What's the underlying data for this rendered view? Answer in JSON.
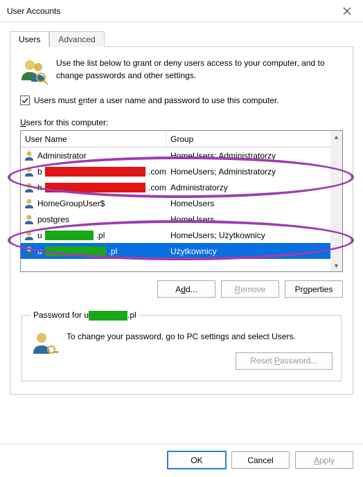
{
  "window": {
    "title": "User Accounts"
  },
  "tabs": {
    "users": "Users",
    "advanced": "Advanced"
  },
  "intro": "Use the list below to grant or deny users access to your computer, and to change passwords and other settings.",
  "checkbox": {
    "checked": true,
    "label_pre": "Users must ",
    "label_ud": "e",
    "label_post": "nter a user name and password to use this computer."
  },
  "list_label_ud": "U",
  "list_label_post": "sers for this computer:",
  "columns": {
    "name": "User Name",
    "group": "Group"
  },
  "rows": [
    {
      "name_pre": "Administrator",
      "name_redact": "",
      "name_suffix": "",
      "group": "HomeUsers; Administratorzy",
      "selected": false
    },
    {
      "name_pre": "b",
      "name_redact": "red",
      "name_suffix": ".com",
      "group": "HomeUsers; Administratorzy",
      "selected": false
    },
    {
      "name_pre": "h",
      "name_redact": "red",
      "name_suffix": ".com",
      "group": "Administratorzy",
      "selected": false
    },
    {
      "name_pre": "HomeGroupUser$",
      "name_redact": "",
      "name_suffix": "",
      "group": "HomeUsers",
      "selected": false
    },
    {
      "name_pre": "postgres",
      "name_redact": "",
      "name_suffix": "",
      "group": "HomeUsers",
      "selected": false
    },
    {
      "name_pre": "u",
      "name_redact": "green",
      "name_suffix": ".pl",
      "group": "HomeUsers; Użytkownicy",
      "selected": false
    },
    {
      "name_pre": "u",
      "name_redact": "green",
      "name_suffix": ".pl",
      "group": "Użytkownicy",
      "selected": true
    }
  ],
  "buttons": {
    "add": "Add...",
    "remove": "Remove",
    "properties": "Properties"
  },
  "password_box": {
    "legend_pre": "Password for u",
    "legend_suffix": ".pl",
    "text": "To change your password, go to PC settings and select Users.",
    "reset": "Reset Password..."
  },
  "footer": {
    "ok": "OK",
    "cancel": "Cancel",
    "apply": "Apply"
  }
}
